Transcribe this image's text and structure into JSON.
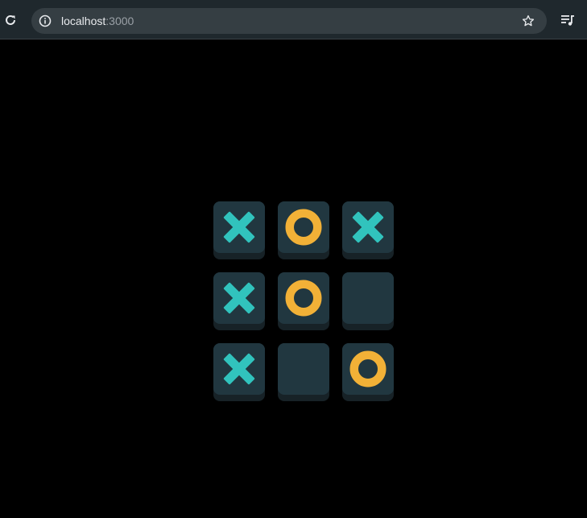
{
  "browser": {
    "url_host": "localhost",
    "url_port": ":3000",
    "icons": {
      "reload": "reload-icon",
      "site_info": "info-icon",
      "bookmark": "star-icon",
      "media": "media-queue-icon"
    }
  },
  "game": {
    "board": [
      [
        "X",
        "O",
        "X"
      ],
      [
        "X",
        "O",
        ""
      ],
      [
        "X",
        "",
        "O"
      ]
    ],
    "colors": {
      "x": "#31c3bd",
      "o": "#f2b137",
      "tile": "#213740",
      "tile_shadow": "#172227",
      "background": "#000000"
    }
  }
}
